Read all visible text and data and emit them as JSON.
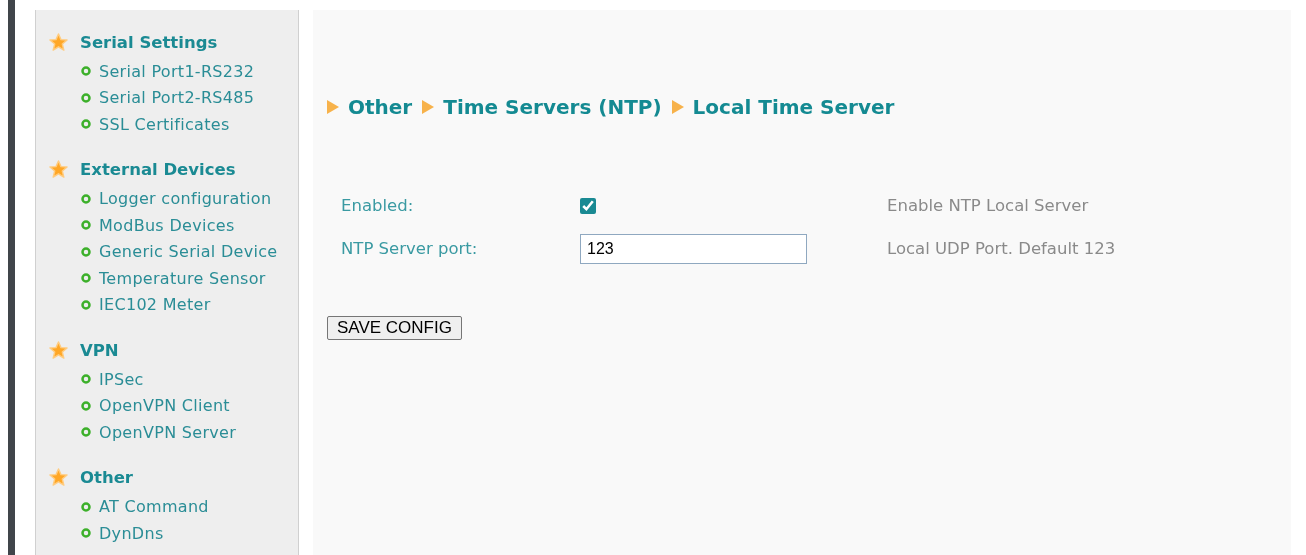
{
  "sidebar": {
    "groups": [
      {
        "title": "Serial Settings",
        "items": [
          "Serial Port1-RS232",
          "Serial Port2-RS485",
          "SSL Certificates"
        ]
      },
      {
        "title": "External Devices",
        "items": [
          "Logger configuration",
          "ModBus Devices",
          "Generic Serial Device",
          "Temperature Sensor",
          "IEC102 Meter"
        ]
      },
      {
        "title": "VPN",
        "items": [
          "IPSec",
          "OpenVPN Client",
          "OpenVPN Server"
        ]
      },
      {
        "title": "Other",
        "items": [
          "AT Command",
          "DynDns"
        ]
      }
    ]
  },
  "breadcrumb": [
    "Other",
    "Time Servers (NTP)",
    "Local Time Server"
  ],
  "form": {
    "rows": [
      {
        "kind": "checkbox",
        "label": "Enabled:",
        "checked": true,
        "help": "Enable NTP Local Server"
      },
      {
        "kind": "text",
        "label": "NTP Server port:",
        "value": "123",
        "help": "Local UDP Port. Default 123"
      }
    ]
  },
  "save_button": "SAVE CONFIG"
}
